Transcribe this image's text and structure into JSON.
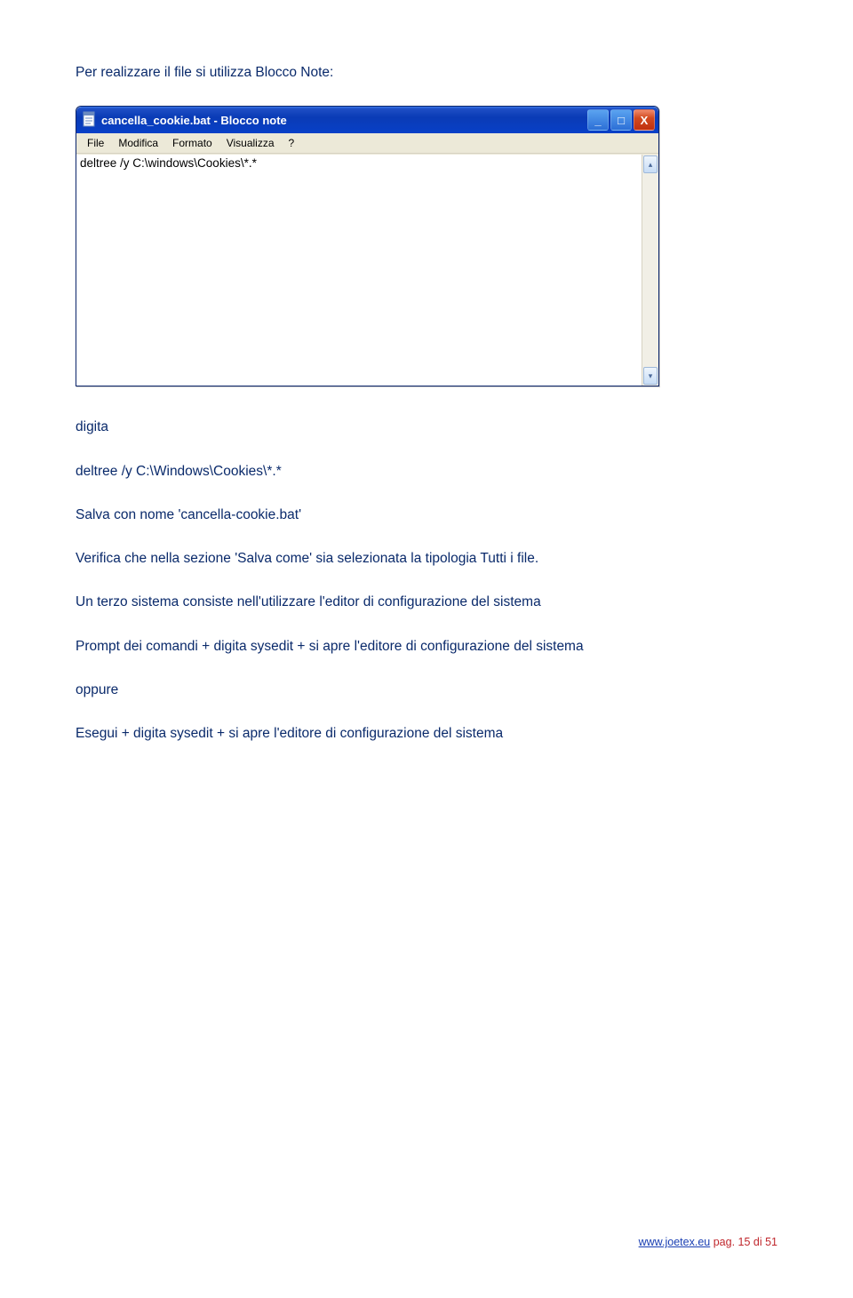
{
  "intro": "Per realizzare il file si utilizza Blocco Note:",
  "notepad": {
    "title": "cancella_cookie.bat - Blocco note",
    "menu": [
      "File",
      "Modifica",
      "Formato",
      "Visualizza",
      "?"
    ],
    "content": "deltree /y C:\\windows\\Cookies\\*.*",
    "win_buttons": {
      "min_glyph": "_",
      "max_glyph": "□",
      "close_glyph": "X"
    },
    "scroll": {
      "up_glyph": "▴",
      "down_glyph": "▾"
    }
  },
  "lines": {
    "digita": "digita",
    "deltree": "deltree /y C:\\Windows\\Cookies\\*.*",
    "salva": "Salva con nome 'cancella-cookie.bat'",
    "verifica": "Verifica che nella sezione 'Salva come' sia selezionata la tipologia Tutti i file.",
    "terzo": "Un terzo sistema consiste nell'utilizzare l'editor di configurazione del sistema",
    "prompt": "Prompt dei comandi + digita sysedit + si apre l'editore di configurazione del sistema",
    "oppure": "oppure",
    "esegui": "Esegui + digita sysedit + si apre l'editore di configurazione del sistema"
  },
  "footer": {
    "site": "www.joetex.eu",
    "page": " pag. 15 di 51"
  }
}
